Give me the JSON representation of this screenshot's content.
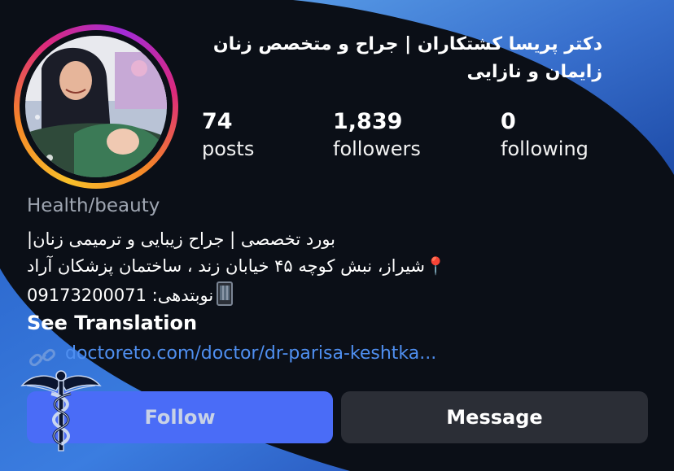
{
  "profile": {
    "name_line1": "دکتر پریسا کشتکاران | جراح و متخصص زنان",
    "name_line2": "زایمان و نازایی",
    "name_overlay_text": "دکتر پریسا کشتکاران",
    "stats": [
      {
        "value": "74",
        "label": "posts"
      },
      {
        "value": "1,839",
        "label": "followers"
      },
      {
        "value": "0",
        "label": "following"
      }
    ],
    "category": "Health/beauty",
    "bio": {
      "line1": "|بورد تخصصی | جراح زیبایی و ترمیمی زنان",
      "line2_pin": "📍",
      "line2": "شیراز، نبش کوچه ۴۵ خیابان زند ، ساختمان پزشکان آراد",
      "line3": "نوبتدهی: 09173200071"
    },
    "see_translation": "See Translation",
    "link": "doctoreto.com/doctor/dr-parisa-keshtka..."
  },
  "actions": {
    "follow_label": "Follow",
    "message_label": "Message"
  },
  "icons": {
    "avatar": "profile-photo-icon",
    "link": "link-icon",
    "phone": "mobile-phone-icon",
    "pin": "location-pin-icon",
    "logo": "caduceus-icon"
  },
  "colors": {
    "background": "#0b0f17",
    "overlay_blue": "#3f76d8",
    "follow_button": "#4a6cf7",
    "message_button": "#2b2e36",
    "link": "#4f8ff0",
    "category": "#9fa6b2"
  }
}
